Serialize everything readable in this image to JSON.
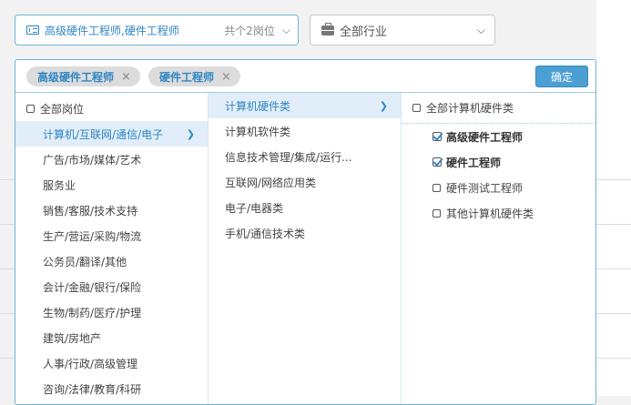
{
  "job_select": {
    "value": "高级硬件工程师,硬件工程师",
    "count": "共个2岗位",
    "icon": "document-icon"
  },
  "industry_select": {
    "value": "全部行业",
    "icon": "briefcase-icon"
  },
  "tags": [
    {
      "label": "高级硬件工程师",
      "remove": "×"
    },
    {
      "label": "硬件工程师",
      "remove": "×"
    }
  ],
  "confirm_label": "确定",
  "categories": {
    "all_label": "全部岗位",
    "items": [
      "计算机/互联网/通信/电子",
      "广告/市场/媒体/艺术",
      "服务业",
      "销售/客服/技术支持",
      "生产/营运/采购/物流",
      "公务员/翻译/其他",
      "会计/金融/银行/保险",
      "生物/制药/医疗/护理",
      "建筑/房地产",
      "人事/行政/高级管理",
      "咨询/法律/教育/科研"
    ],
    "selected_index": 0
  },
  "subcategories": {
    "items": [
      "计算机硬件类",
      "计算机软件类",
      "信息技术管理/集成/运行...",
      "互联网/网络应用类",
      "电子/电器类",
      "手机/通信技术类"
    ],
    "selected_index": 0
  },
  "positions": {
    "all_label": "全部计算机硬件类",
    "items": [
      {
        "label": "高级硬件工程师",
        "checked": true
      },
      {
        "label": "硬件工程师",
        "checked": true
      },
      {
        "label": "硬件测试工程师",
        "checked": false
      },
      {
        "label": "其他计算机硬件类",
        "checked": false
      }
    ]
  },
  "colors": {
    "accent": "#2f86c4",
    "confirm_bg": "#4b9fd3",
    "panel_border": "#6fb3d8"
  }
}
